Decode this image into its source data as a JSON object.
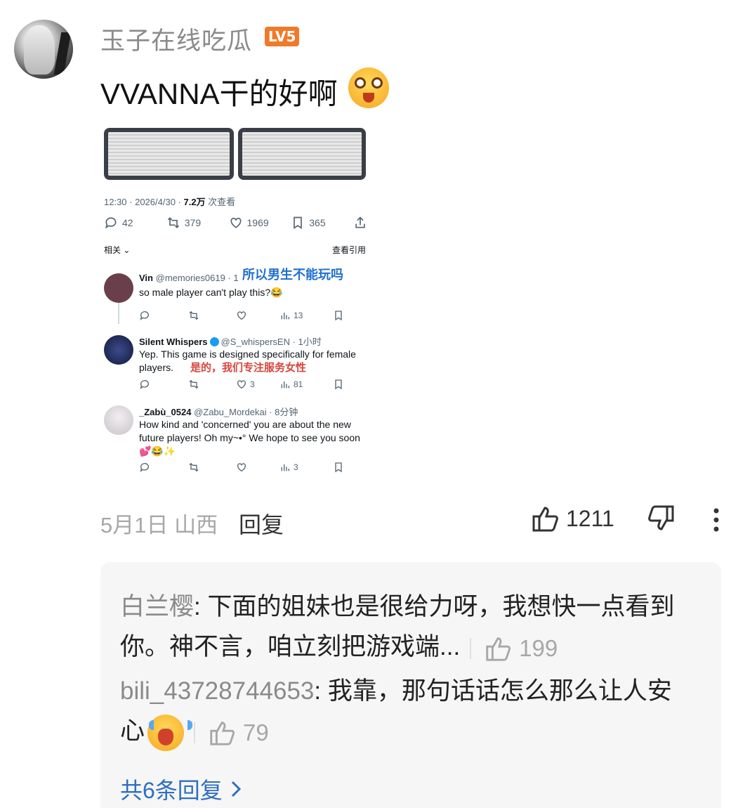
{
  "comment": {
    "username": "玉子在线吃瓜",
    "level_badge": "LV5",
    "text": "VVANNA干的好啊",
    "date": "5月1日",
    "location": "山西",
    "reply_label": "回复",
    "like_count": "1211"
  },
  "embedded_post": {
    "meta_time": "12:30 · 2026/4/30 · ",
    "meta_views": "7.2万",
    "meta_views_suffix": " 次查看",
    "stats": {
      "replies": "42",
      "reposts": "379",
      "likes": "1969",
      "bookmarks": "365"
    },
    "related_label": "相关",
    "quote_label": "查看引用",
    "tweets": [
      {
        "name": "Vin",
        "handle": "@memories0619 · 1",
        "text": "so male player can't play this?😂",
        "overlay_cn": "所以男生不能玩吗",
        "views": "13"
      },
      {
        "name": "Silent Whispers",
        "handle": "@S_whispersEN · 1小时",
        "text": "Yep. This game is designed specifically for female players.",
        "overlay_cn": "是的，我们专注服务女性",
        "likes": "3",
        "views": "81"
      },
      {
        "name": "_Zabù_0524",
        "handle": "@Zabu_Mordekai · 8分钟",
        "text": "How kind and 'concerned' you are about the new future players! Oh my~•° We hope to see you soon",
        "emoji_line": "💕😂✨",
        "views": "3"
      }
    ]
  },
  "replies": [
    {
      "author": "白兰樱",
      "text": ": 下面的姐妹也是很给力呀，我想快一点看到你。神不言，咱立刻把游戏端...",
      "likes": "199"
    },
    {
      "author": "bili_43728744653",
      "text": ": 我靠，那句话话怎么那么让人安心",
      "likes": "79"
    }
  ],
  "more_replies_label": "共6条回复"
}
